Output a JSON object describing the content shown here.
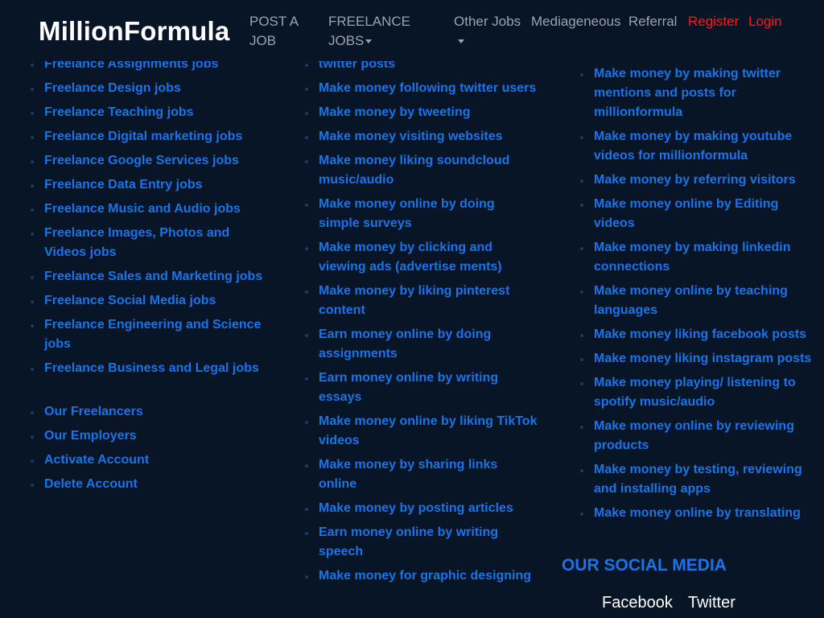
{
  "header": {
    "brand": "MillionFormula",
    "nav": {
      "post_job_line1": "POST A",
      "post_job_line2": "JOB",
      "freelance_jobs_line1": "FREELANCE",
      "freelance_jobs_line2": "JOBS",
      "other_jobs": "Other Jobs",
      "mediageneous": "Mediageneous",
      "referral": "Referral",
      "register": "Register",
      "login": "Login"
    },
    "colors": {
      "background": "#071527",
      "nav_text": "#9aa3ad",
      "auth_text": "#ff1a1a",
      "link": "#1a73e8"
    }
  },
  "columns": {
    "freelance": [
      "Freelance Assignments jobs",
      "Freelance Design jobs",
      "Freelance Teaching jobs",
      "Freelance Digital marketing jobs",
      "Freelance Google Services jobs",
      "Freelance Data Entry jobs",
      "Freelance Music and Audio jobs",
      "Freelance Images, Photos and Videos jobs",
      "Freelance Sales and Marketing jobs",
      "Freelance Social Media jobs",
      "Freelance Engineering and Science jobs",
      "Freelance Business and Legal jobs"
    ],
    "account": [
      "Our Freelancers",
      "Our Employers",
      "Activate Account",
      "Delete Account"
    ],
    "make_money": [
      "twitter posts",
      "Make money following twitter users",
      "Make money by tweeting",
      "Make money visiting websites",
      "Make money liking soundcloud music/audio",
      "Make money online by doing simple surveys",
      "Make money by clicking and viewing ads (advertise ments)",
      "Make money by liking pinterest content",
      "Earn money online by doing assignments",
      "Earn money online by writing essays",
      "Make money online by liking TikTok videos",
      "Make money by sharing links online",
      "Make money by posting articles",
      "Earn money online by writing speech",
      "Make money for graphic designing"
    ],
    "more_money": [
      "Make money by making twitter mentions and posts for millionformula",
      "Make money by making youtube videos for millionformula",
      "Make money by referring visitors",
      "Make money online by Editing videos",
      "Make money by making linkedin connections",
      "Make money online by teaching languages",
      "Make money liking facebook posts",
      "Make money liking instagram posts",
      "Make money playing/ listening to spotify music/audio",
      "Make money online by reviewing products",
      "Make money by testing, reviewing and installing apps",
      "Make money online by translating"
    ]
  },
  "social": {
    "heading": "OUR SOCIAL MEDIA",
    "facebook": "Facebook",
    "twitter": "Twitter"
  }
}
